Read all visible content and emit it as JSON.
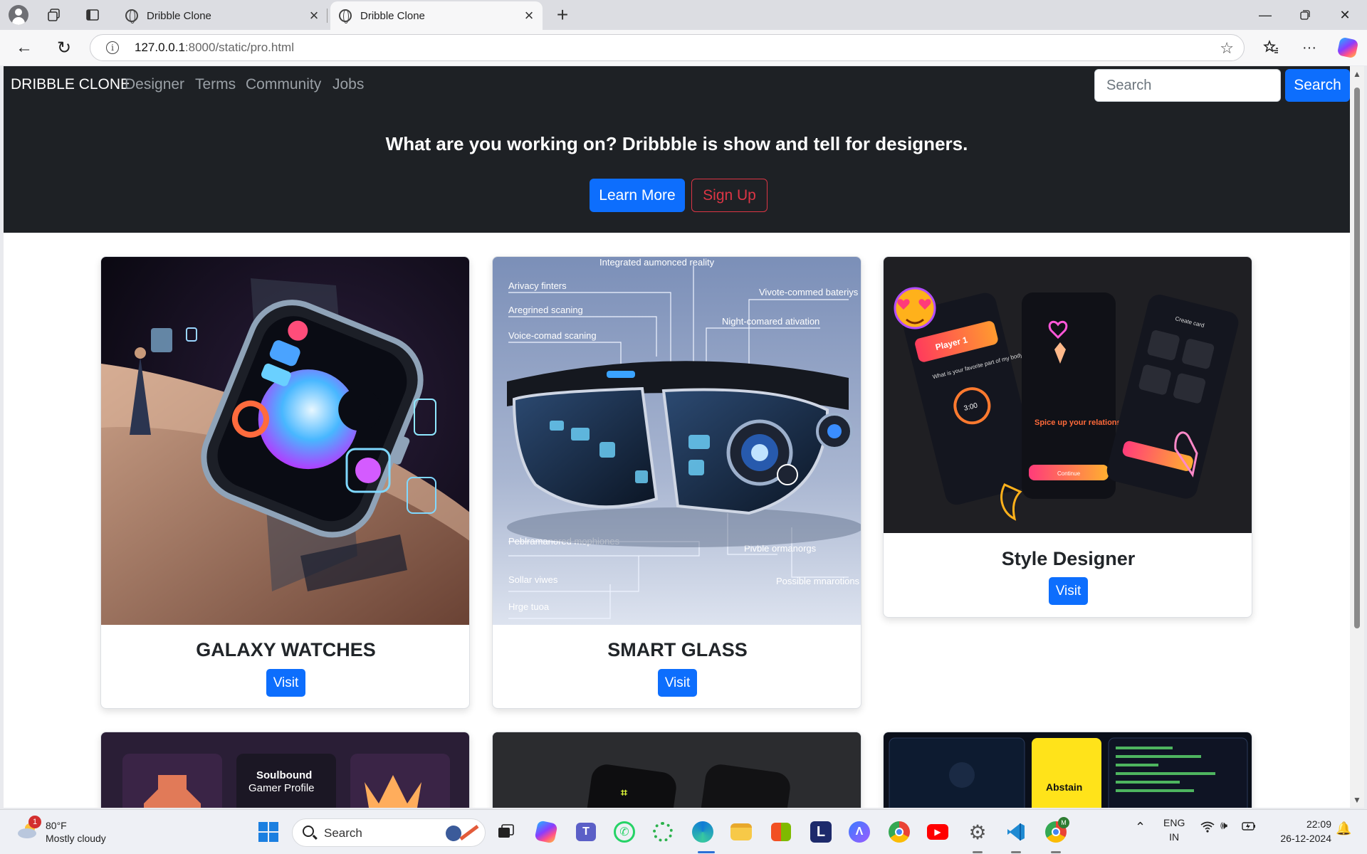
{
  "browser": {
    "tabs": [
      {
        "title": "Dribble Clone"
      },
      {
        "title": "Dribble Clone"
      }
    ],
    "url_host": "127.0.0.1",
    "url_path": ":8000/static/pro.html"
  },
  "site": {
    "brand": "DRIBBLE CLONE",
    "nav": [
      "Designer",
      "Terms",
      "Community",
      "Jobs"
    ],
    "search_placeholder": "Search",
    "search_button": "Search",
    "hero_title": "What are you working on? Dribbble is show and tell for designers.",
    "learn_more": "Learn More",
    "sign_up": "Sign Up",
    "cards": [
      {
        "title": "GALAXY WATCHES",
        "button": "Visit"
      },
      {
        "title": "SMART GLASS",
        "button": "Visit"
      },
      {
        "title": "Style Designer",
        "button": "Visit"
      }
    ],
    "glass_labels": [
      "Integrated aumonced reality",
      "Arivacy finters",
      "Aregrined scaning",
      "Voice-comad scaning",
      "Vivote-commed bateriys",
      "Night-comared ativation",
      "Peblramanored mophiones",
      "Pivble ormanorgs",
      "Sollar viwes",
      "Possible mnarotions",
      "Hrge tuoa"
    ],
    "style_labels": [
      "Player 1",
      "What is your favorite part of my body?",
      "3:00",
      "Spice up your relationship",
      "Continue",
      "Create card"
    ],
    "bottom_labels": [
      "Soulbound",
      "Gamer Profile",
      "Abstain"
    ]
  },
  "taskbar": {
    "weather_temp": "80°F",
    "weather_cond": "Mostly cloudy",
    "weather_badge": "1",
    "search_label": "Search",
    "lang_1": "ENG",
    "lang_2": "IN",
    "time": "22:09",
    "date": "26-12-2024"
  },
  "colors": {
    "primary": "#0d6efd",
    "danger": "#dc3545",
    "navbar": "#1e2125"
  }
}
